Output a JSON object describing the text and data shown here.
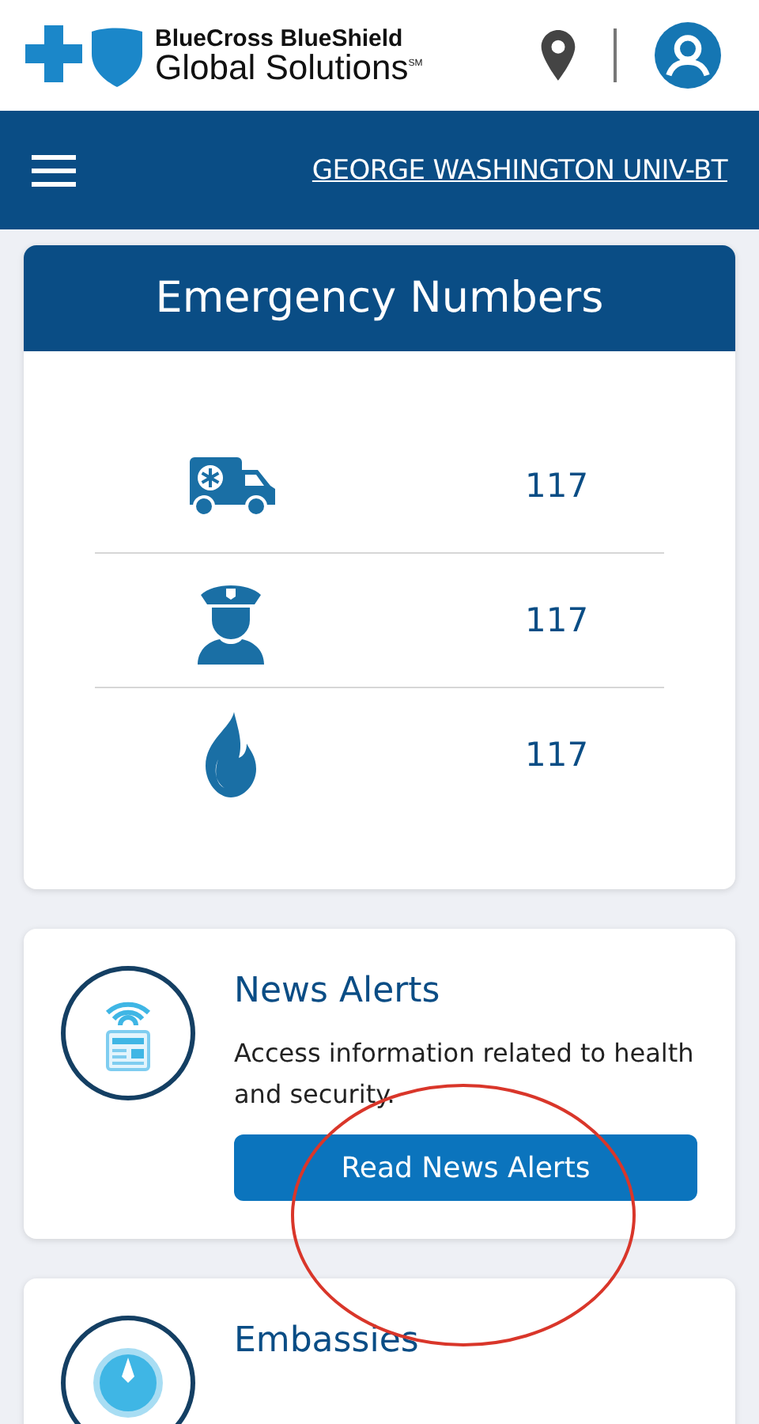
{
  "header": {
    "brand_line_1": "BlueCross BlueShield",
    "brand_line_2": "Global Solutions$^{SM}$"
  },
  "nav": {
    "account_name": "GEORGE WASHINGTON UNIV-BT"
  },
  "emergency": {
    "title": "Emergency Numbers",
    "rows": [
      {
        "kind": "ambulance",
        "number": "117"
      },
      {
        "kind": "police",
        "number": "117"
      },
      {
        "kind": "fire",
        "number": "117"
      }
    ]
  },
  "cards": [
    {
      "kind": "news",
      "title": "News Alerts",
      "description": "Access information related to health and security.",
      "button": "Read News Alerts"
    },
    {
      "kind": "embassy",
      "title": "Embassies"
    }
  ]
}
